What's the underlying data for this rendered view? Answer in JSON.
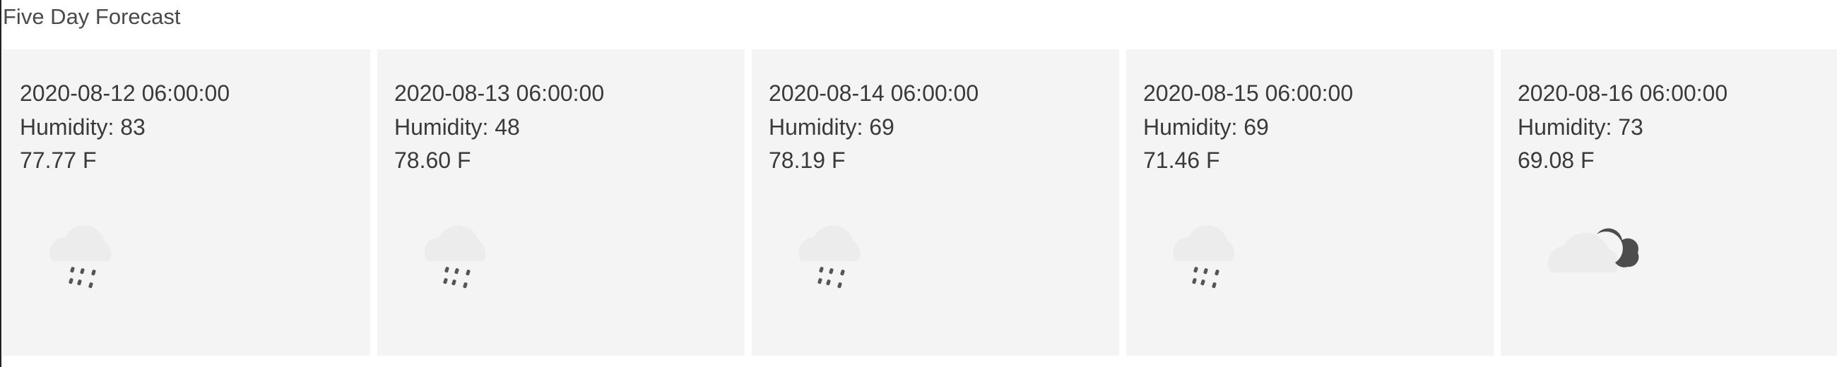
{
  "page": {
    "title": "Five Day Forecast"
  },
  "forecast": [
    {
      "date": "2020-08-12 06:00:00",
      "humidity": "Humidity: 83",
      "temp": "77.77 F",
      "icon": "rain-night-icon"
    },
    {
      "date": "2020-08-13 06:00:00",
      "humidity": "Humidity: 48",
      "temp": "78.60 F",
      "icon": "rain-night-icon"
    },
    {
      "date": "2020-08-14 06:00:00",
      "humidity": "Humidity: 69",
      "temp": "78.19 F",
      "icon": "rain-night-icon"
    },
    {
      "date": "2020-08-15 06:00:00",
      "humidity": "Humidity: 69",
      "temp": "71.46 F",
      "icon": "rain-night-icon"
    },
    {
      "date": "2020-08-16 06:00:00",
      "humidity": "Humidity: 73",
      "temp": "69.08 F",
      "icon": "cloudy-night-icon"
    }
  ],
  "colors": {
    "card_background": "#f4f4f4",
    "icon_dark": "#4d4d4d",
    "cloud_light": "#ececec"
  }
}
